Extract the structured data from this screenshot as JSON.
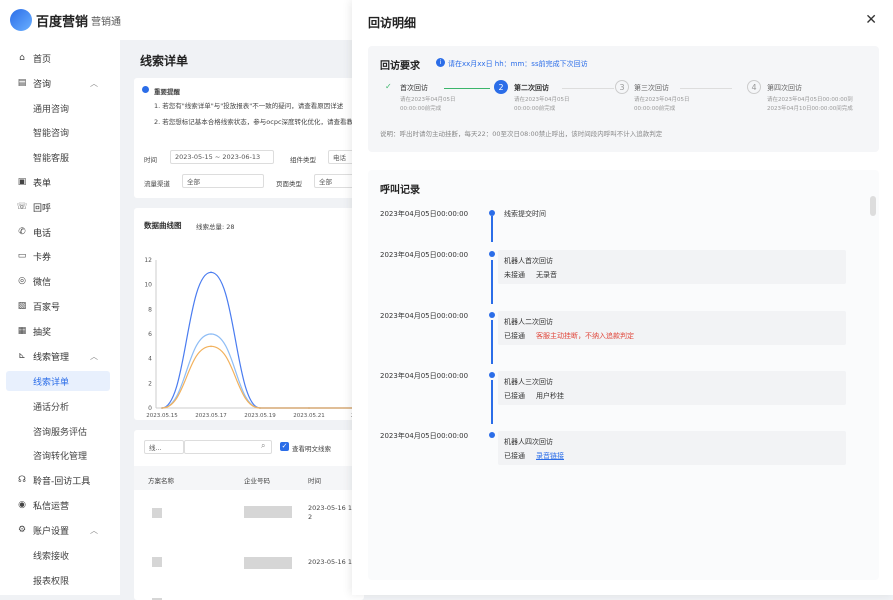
{
  "brand": {
    "name": "百度营销",
    "sub": "营销通"
  },
  "sidebar": {
    "items": [
      {
        "label": "首页",
        "icon": "home-icon",
        "glyph": "⌂"
      },
      {
        "label": "咨询",
        "icon": "chat-icon",
        "glyph": "▤"
      },
      {
        "label": "表单",
        "icon": "form-icon",
        "glyph": "▣"
      },
      {
        "label": "回呼",
        "icon": "callback-icon",
        "glyph": "☏"
      },
      {
        "label": "电话",
        "icon": "phone-icon",
        "glyph": "✆"
      },
      {
        "label": "卡券",
        "icon": "coupon-icon",
        "glyph": "▭"
      },
      {
        "label": "微信",
        "icon": "wechat-icon",
        "glyph": "◎"
      },
      {
        "label": "百家号",
        "icon": "baijiahao-icon",
        "glyph": "▧"
      },
      {
        "label": "抽奖",
        "icon": "lottery-icon",
        "glyph": "▦"
      },
      {
        "label": "线索管理",
        "icon": "chart-icon",
        "glyph": "⊾"
      },
      {
        "label": "聆音-回访工具",
        "icon": "headset-icon",
        "glyph": "☊"
      },
      {
        "label": "私信运营",
        "icon": "message-icon",
        "glyph": "◉"
      },
      {
        "label": "账户设置",
        "icon": "settings-icon",
        "glyph": "⚙"
      }
    ],
    "sub_consult": [
      "通用咨询",
      "智能咨询",
      "智能客服"
    ],
    "sub_leads": [
      "线索详单",
      "通话分析",
      "咨询服务评估",
      "咨询转化管理"
    ],
    "sub_account": [
      "线索接收",
      "报表权限"
    ]
  },
  "main": {
    "title": "线索详单",
    "notice_title": "重要提醒",
    "notice_1": "1. 若您有\"线索详单\"与\"投放报表\"不一致的疑问，请查看原因详述",
    "notice_2": "2. 若您想标记基本合格线索状态，参与ocpc深度转化优化，请查看教",
    "filter_time_label": "时间",
    "filter_time_value": "2023-05-15 ~ 2023-06-13",
    "filter_component_label": "组件类型",
    "filter_component_value": "电话",
    "filter_channel_label": "流量渠道",
    "filter_channel_value": "全部",
    "filter_pagetype_label": "页面类型",
    "filter_pagetype_value": "全部",
    "chart_title": "数据曲线图",
    "chart_total": "线索总量: 28",
    "search_select": "线...",
    "checkbox_label": "查看明文线索",
    "col_plan": "方案名称",
    "col_account": "企业号码",
    "col_time": "时间",
    "row_times": [
      "2023-05-16 1\n2",
      "2023-05-16 1",
      "2023-05-16 1\n0"
    ]
  },
  "chart_data": {
    "type": "line",
    "x": [
      "2023.05.15",
      "2023.05.17",
      "2023.05.19",
      "2023.05.21",
      "2023"
    ],
    "ylim": [
      0,
      12
    ],
    "yticks": [
      0,
      2,
      4,
      6,
      8,
      10,
      12
    ],
    "series": [
      {
        "name": "",
        "color": "#4a7cf0",
        "values": [
          0,
          11,
          0,
          0,
          0
        ]
      },
      {
        "name": "",
        "color": "#8fbdf5",
        "values": [
          0,
          6,
          0,
          0,
          0
        ]
      },
      {
        "name": "",
        "color": "#f2b15c",
        "values": [
          0,
          5,
          0,
          0,
          0
        ]
      }
    ]
  },
  "drawer": {
    "title": "回访明细",
    "req_title": "回访要求",
    "req_hint": "请在xx月xx日 hh：mm：ss前完成下次回访",
    "steps": [
      {
        "num": "✓",
        "title": "首次回访",
        "desc1": "请在2023年04月05日",
        "desc2": "00:00:00前完成"
      },
      {
        "num": "2",
        "title": "第二次回访",
        "desc1": "请在2023年04月05日",
        "desc2": "00:00:00前完成"
      },
      {
        "num": "3",
        "title": "第三次回访",
        "desc1": "请在2023年04月05日",
        "desc2": "00:00:00前完成"
      },
      {
        "num": "4",
        "title": "第四次回访",
        "desc1": "请在2023年04月05日00:00:00到",
        "desc2": "2023年04月10日00:00:00间完成"
      }
    ],
    "note": "说明：呼出时请勿主动挂断，每天22：00至次日08:00禁止呼出，该时间段内呼叫不计入追款判定",
    "call_title": "呼叫记录",
    "records": [
      {
        "time": "2023年04月05日00:00:00",
        "title": "线索提交时间",
        "status": "",
        "detail": "",
        "detail_type": "none"
      },
      {
        "time": "2023年04月05日00:00:00",
        "title": "机器人首次回访",
        "status": "未接通",
        "detail": "无录音",
        "detail_type": "normal"
      },
      {
        "time": "2023年04月05日00:00:00",
        "title": "机器人二次回访",
        "status": "已接通",
        "detail": "客服主动挂断，不纳入追款判定",
        "detail_type": "warn"
      },
      {
        "time": "2023年04月05日00:00:00",
        "title": "机器人三次回访",
        "status": "已接通",
        "detail": "用户秒挂",
        "detail_type": "normal"
      },
      {
        "time": "2023年04月05日00:00:00",
        "title": "机器人四次回访",
        "status": "已接通",
        "detail": "录音链接",
        "detail_type": "link"
      }
    ]
  }
}
